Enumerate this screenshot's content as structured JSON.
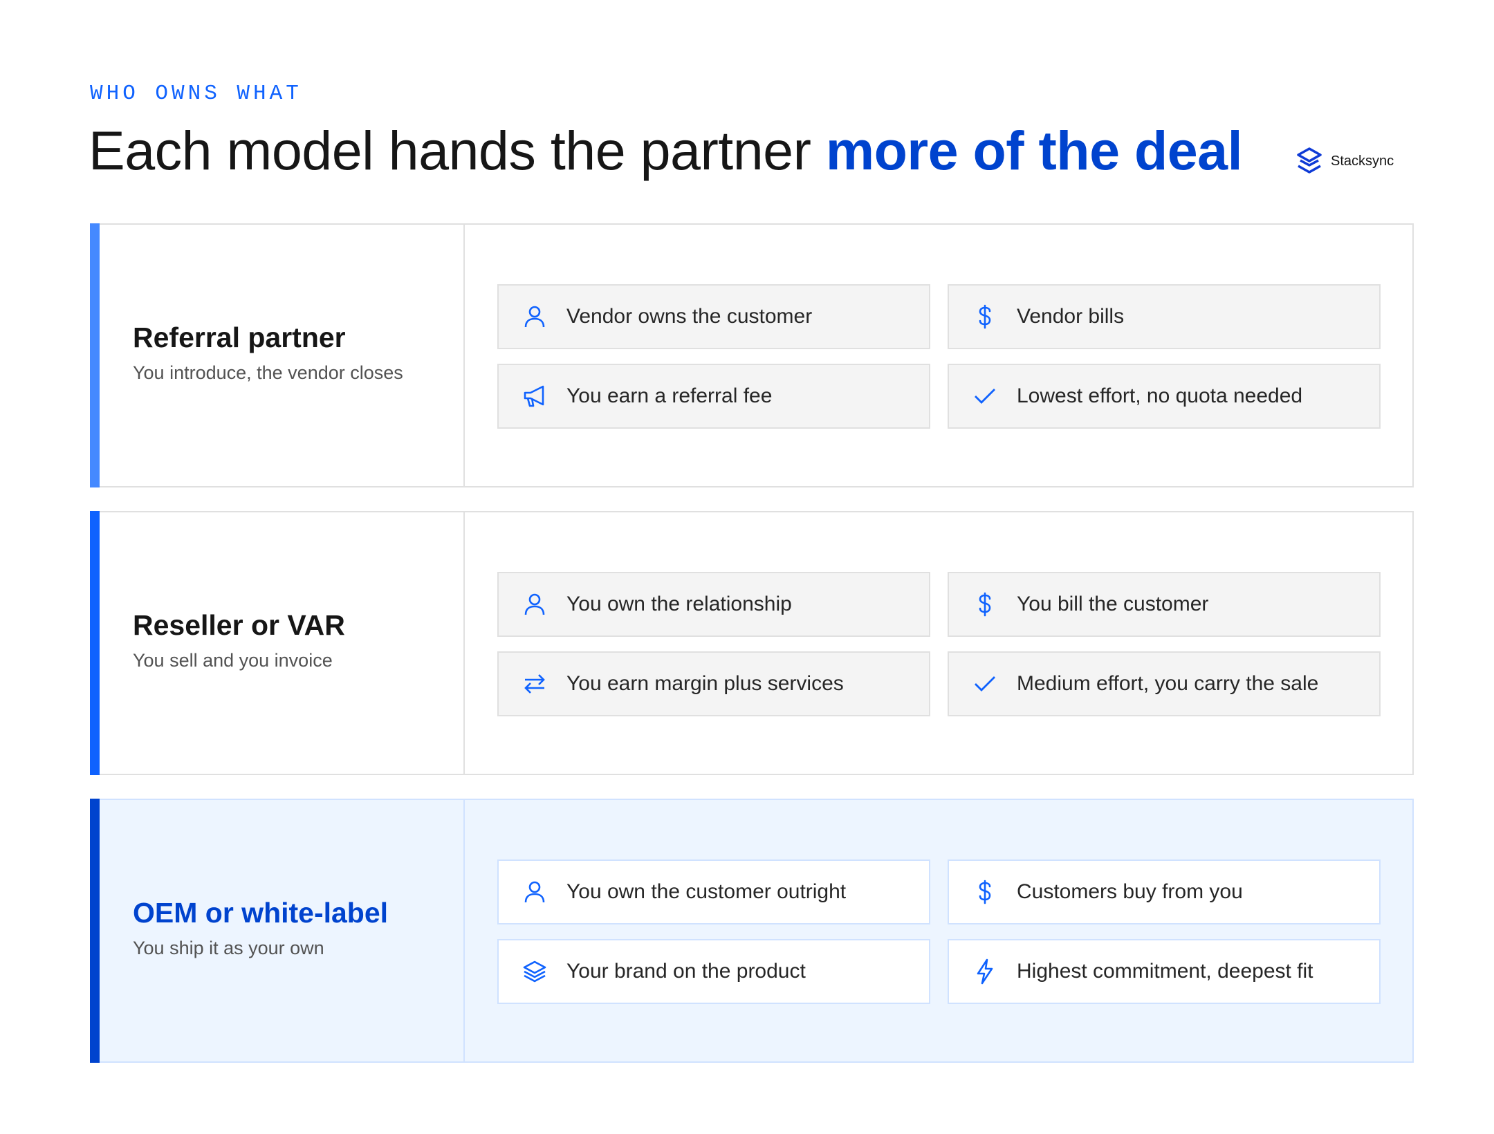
{
  "header": {
    "eyebrow": "WHO OWNS WHAT",
    "title_plain": "Each model hands the partner ",
    "title_highlight": "more of the deal",
    "brand": "Stacksync"
  },
  "colors": {
    "accent": "#0f62fe",
    "accent_dark": "#0043ce",
    "accent_light": "#4589ff",
    "highlight_bg": "#edf5ff"
  },
  "rows": [
    {
      "name": "Referral partner",
      "subtitle": "You introduce, the vendor closes",
      "cells": [
        {
          "icon": "user-icon",
          "text": "Vendor owns the customer"
        },
        {
          "icon": "dollar-icon",
          "text": "Vendor bills"
        },
        {
          "icon": "megaphone-icon",
          "text": "You earn a referral fee"
        },
        {
          "icon": "checkmark-icon",
          "text": "Lowest effort, no quota needed"
        }
      ]
    },
    {
      "name": "Reseller or VAR",
      "subtitle": "You sell and you invoice",
      "cells": [
        {
          "icon": "user-icon",
          "text": "You own the relationship"
        },
        {
          "icon": "dollar-icon",
          "text": "You bill the customer"
        },
        {
          "icon": "arrows-exchange-icon",
          "text": "You earn margin plus services"
        },
        {
          "icon": "checkmark-icon",
          "text": "Medium effort, you carry the sale"
        }
      ]
    },
    {
      "name": "OEM or white-label",
      "subtitle": "You ship it as your own",
      "cells": [
        {
          "icon": "user-icon",
          "text": "You own the customer outright"
        },
        {
          "icon": "dollar-icon",
          "text": "Customers buy from you"
        },
        {
          "icon": "layers-icon",
          "text": "Your brand on the product"
        },
        {
          "icon": "lightning-icon",
          "text": "Highest commitment, deepest fit"
        }
      ]
    }
  ]
}
